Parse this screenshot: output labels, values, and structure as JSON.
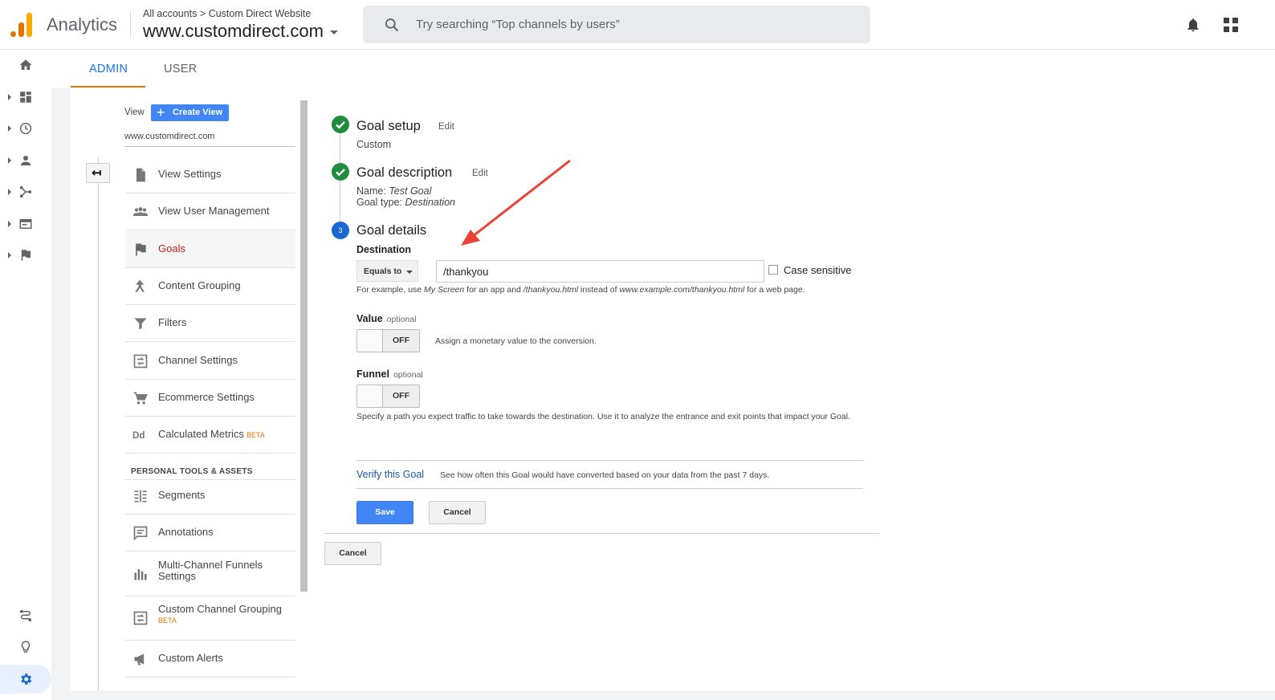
{
  "header": {
    "app_title": "Analytics",
    "breadcrumb_all": "All accounts",
    "breadcrumb_sep": ">",
    "breadcrumb_property": "Custom Direct Website",
    "view_name": "www.customdirect.com",
    "search_placeholder": "Try searching “Top channels by users”"
  },
  "tabs": {
    "admin": "ADMIN",
    "user": "USER"
  },
  "view_column": {
    "view_label": "View",
    "create_view": "Create View",
    "view_name": "www.customdirect.com",
    "items": [
      {
        "label": "View Settings",
        "icon": "document-icon"
      },
      {
        "label": "View User Management",
        "icon": "people-icon"
      },
      {
        "label": "Goals",
        "icon": "flag-icon",
        "active": true
      },
      {
        "label": "Content Grouping",
        "icon": "grouping-icon"
      },
      {
        "label": "Filters",
        "icon": "filter-icon"
      },
      {
        "label": "Channel Settings",
        "icon": "channel-icon"
      },
      {
        "label": "Ecommerce Settings",
        "icon": "cart-icon"
      },
      {
        "label": "Calculated Metrics",
        "badge": "BETA",
        "icon": "dd-icon"
      }
    ],
    "section_title": "PERSONAL TOOLS & ASSETS",
    "tools": [
      {
        "label": "Segments",
        "icon": "segments-icon"
      },
      {
        "label": "Annotations",
        "icon": "annotations-icon"
      },
      {
        "label": "Multi-Channel Funnels Settings",
        "icon": "bar-chart-icon"
      },
      {
        "label": "Custom Channel Grouping",
        "badge": "BETA",
        "icon": "channel-icon"
      },
      {
        "label": "Custom Alerts",
        "icon": "megaphone-icon"
      }
    ]
  },
  "goal": {
    "step1": {
      "title": "Goal setup",
      "edit": "Edit",
      "value": "Custom"
    },
    "step2": {
      "title": "Goal description",
      "edit": "Edit",
      "name_label": "Name:",
      "name_value": "Test Goal",
      "type_label": "Goal type:",
      "type_value": "Destination"
    },
    "step3": {
      "number": "3",
      "title": "Goal details"
    },
    "destination": {
      "label": "Destination",
      "match_type": "Equals to",
      "value": "/thankyou",
      "case_sensitive": "Case sensitive",
      "example": {
        "p1": "For example, use ",
        "i1": "My Screen",
        "p2": " for an app and ",
        "i2": "/thankyou.html",
        "p3": " instead of ",
        "i3": "www.example.com/thankyou.html",
        "p4": " for a web page."
      }
    },
    "value_field": {
      "label": "Value",
      "optional": "optional",
      "state": "OFF",
      "hint": "Assign a monetary value to the conversion."
    },
    "funnel_field": {
      "label": "Funnel",
      "optional": "optional",
      "state": "OFF",
      "hint": "Specify a path you expect traffic to take towards the destination. Use it to analyze the entrance and exit points that impact your Goal."
    },
    "verify": {
      "link": "Verify this Goal",
      "desc": "See how often this Goal would have converted based on your data from the past 7 days."
    },
    "save": "Save",
    "cancel": "Cancel",
    "cancel_outer": "Cancel"
  },
  "colors": {
    "accent_blue": "#1a73e8",
    "goal_active": "#c5221f",
    "step_done": "#1e8e3e",
    "annotation_arrow": "#ea4335"
  }
}
